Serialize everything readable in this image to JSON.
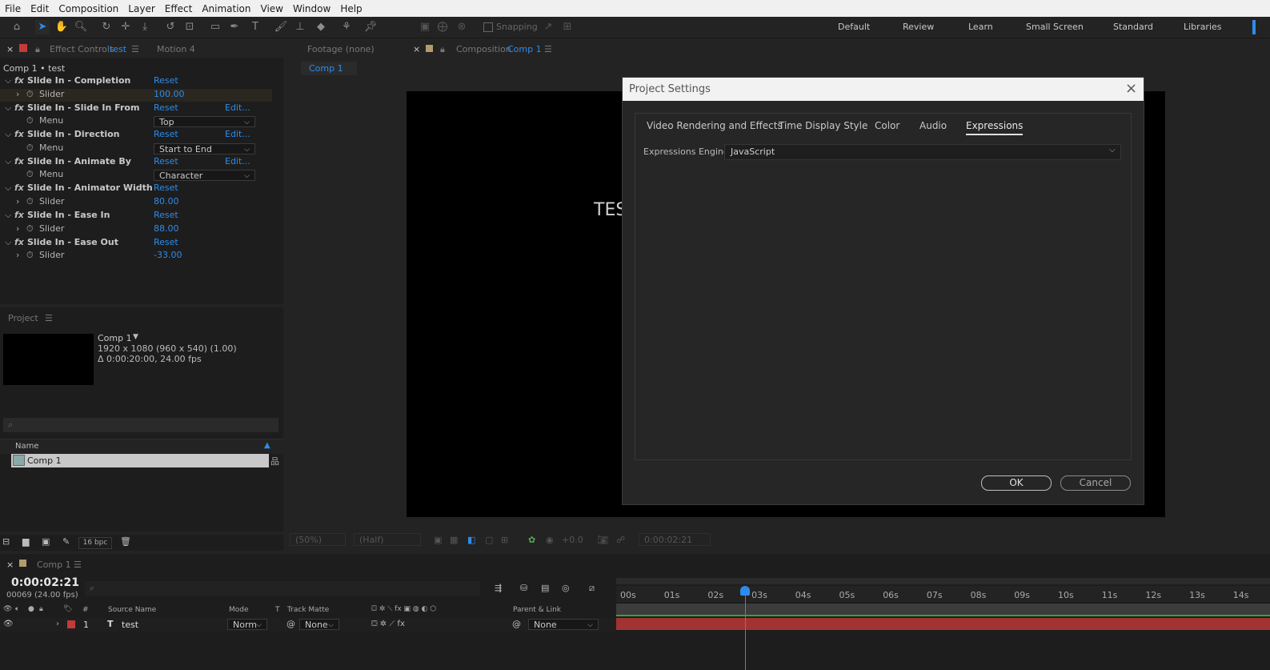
{
  "menu": [
    "File",
    "Edit",
    "Composition",
    "Layer",
    "Effect",
    "Animation",
    "View",
    "Window",
    "Help"
  ],
  "toolbar": {
    "snapping_label": "Snapping",
    "workspaces": [
      "Default",
      "Review",
      "Learn",
      "Small Screen",
      "Standard",
      "Libraries"
    ]
  },
  "effect_controls": {
    "tab_prefix": "Effect Controls",
    "tab_layer": "test",
    "tab2": "Motion 4",
    "header": "Comp 1 • test",
    "reset": "Reset",
    "edit": "Edit...",
    "effects": [
      {
        "name": "Slide In - Completion",
        "sub": "Slider",
        "value": "100.00",
        "has_edit": false,
        "is_menu": false
      },
      {
        "name": "Slide In - Slide In From",
        "sub": "Menu",
        "value": "Top",
        "has_edit": true,
        "is_menu": true
      },
      {
        "name": "Slide In - Direction",
        "sub": "Menu",
        "value": "Start to End",
        "has_edit": true,
        "is_menu": true
      },
      {
        "name": "Slide In - Animate By",
        "sub": "Menu",
        "value": "Character",
        "has_edit": true,
        "is_menu": true
      },
      {
        "name": "Slide In - Animator Width",
        "sub": "Slider",
        "value": "80.00",
        "has_edit": false,
        "is_menu": false
      },
      {
        "name": "Slide In - Ease In",
        "sub": "Slider",
        "value": "88.00",
        "has_edit": false,
        "is_menu": false
      },
      {
        "name": "Slide In - Ease Out",
        "sub": "Slider",
        "value": "-33.00",
        "has_edit": false,
        "is_menu": false
      }
    ]
  },
  "project": {
    "tab": "Project",
    "comp_name": "Comp 1",
    "comp_res": "1920 x 1080  (960 x 540) (1.00)",
    "comp_dur": "Δ 0:00:20:00, 24.00 fps",
    "col_name": "Name",
    "item": "Comp 1",
    "bpc": "16 bpc"
  },
  "viewer": {
    "footage_tab": "Footage  (none)",
    "comp_tab_prefix": "Composition",
    "comp_tab_name": "Comp 1",
    "crumb": "Comp 1",
    "canvas_text": "TES",
    "zoom": "(50%)",
    "resolution": "(Half)",
    "exposure": "+0.0",
    "timecode": "0:00:02:21"
  },
  "dialog": {
    "title": "Project Settings",
    "tabs": [
      "Video Rendering and Effects",
      "Time Display Style",
      "Color",
      "Audio",
      "Expressions"
    ],
    "active_tab": "Expressions",
    "engine_label": "Expressions Engine:",
    "engine_value": "JavaScript",
    "ok": "OK",
    "cancel": "Cancel"
  },
  "timeline": {
    "tab": "Comp 1",
    "timecode": "0:00:02:21",
    "frames": "00069 (24.00 fps)",
    "cols": {
      "num": "#",
      "source": "Source Name",
      "mode": "Mode",
      "t": "T",
      "matte": "Track Matte",
      "parent": "Parent & Link"
    },
    "layer": {
      "num": "1",
      "name": "test",
      "mode": "Norm",
      "matte": "None",
      "parent": "None"
    },
    "ruler": [
      "00s",
      "01s",
      "02s",
      "03s",
      "04s",
      "05s",
      "06s",
      "07s",
      "08s",
      "09s",
      "10s",
      "11s",
      "12s",
      "13s",
      "14s"
    ]
  },
  "colors": {
    "accent": "#2d8ceb",
    "layer_label": "#c43a3a",
    "bar_green": "#3aa23a",
    "bar_red": "#a33333"
  }
}
